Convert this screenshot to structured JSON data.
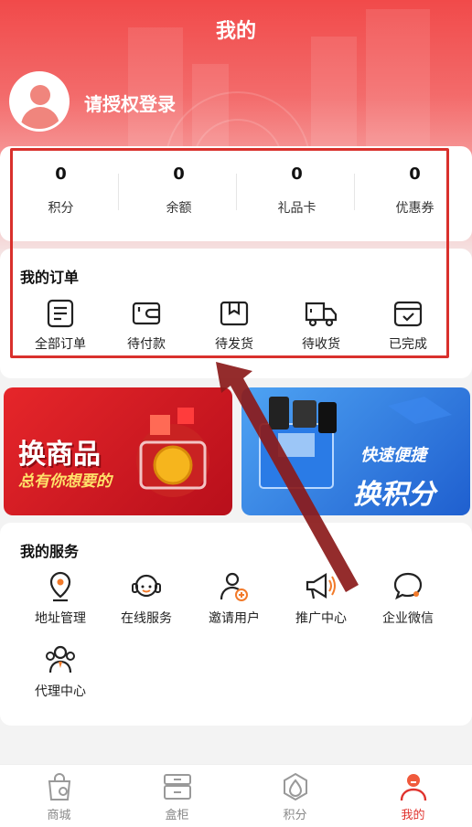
{
  "header": {
    "title": "我的"
  },
  "user": {
    "login_text": "请授权登录"
  },
  "stats": [
    {
      "value": "0",
      "label": "积分"
    },
    {
      "value": "0",
      "label": "余额"
    },
    {
      "value": "0",
      "label": "礼品卡"
    },
    {
      "value": "0",
      "label": "优惠券"
    }
  ],
  "orders": {
    "title": "我的订单",
    "items": [
      {
        "label": "全部订单",
        "icon": "order-list-icon"
      },
      {
        "label": "待付款",
        "icon": "wallet-icon"
      },
      {
        "label": "待发货",
        "icon": "box-icon"
      },
      {
        "label": "待收货",
        "icon": "truck-icon"
      },
      {
        "label": "已完成",
        "icon": "completed-box-icon"
      }
    ]
  },
  "banners": {
    "left": {
      "line1": "换商品",
      "line2": "总有你想要的"
    },
    "right": {
      "line1": "快速便捷",
      "line2": "换积分"
    }
  },
  "services": {
    "title": "我的服务",
    "items": [
      {
        "label": "地址管理",
        "icon": "location-icon"
      },
      {
        "label": "在线服务",
        "icon": "headset-icon"
      },
      {
        "label": "邀请用户",
        "icon": "invite-user-icon"
      },
      {
        "label": "推广中心",
        "icon": "megaphone-icon"
      },
      {
        "label": "企业微信",
        "icon": "chat-icon"
      },
      {
        "label": "代理中心",
        "icon": "agent-group-icon"
      }
    ]
  },
  "tabbar": [
    {
      "label": "商城",
      "icon": "shop-bag-icon"
    },
    {
      "label": "盒柜",
      "icon": "cabinet-icon"
    },
    {
      "label": "积分",
      "icon": "points-drop-icon"
    },
    {
      "label": "我的",
      "icon": "profile-icon",
      "active": true
    }
  ],
  "colors": {
    "accent": "#e0332e",
    "highlight_box": "#d9302c",
    "arrow": "#8b1a1a"
  }
}
